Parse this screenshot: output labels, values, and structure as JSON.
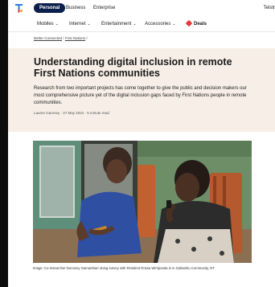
{
  "top_tabs": {
    "personal": "Personal",
    "business": "Business",
    "enterprise": "Enterprise",
    "right_link": "Telstr"
  },
  "nav": {
    "items": [
      {
        "label": "Mobiles"
      },
      {
        "label": "Internet"
      },
      {
        "label": "Entertainment"
      },
      {
        "label": "Accessories"
      }
    ],
    "deals": "Deals"
  },
  "breadcrumb": {
    "item1": "Better Connected",
    "sep": "/",
    "item2": "First Nations"
  },
  "article": {
    "title": "Understanding digital inclusion in remote First Nations communities",
    "description": "Research from two important projects has come together to give the public and decision makers our most comprehensive picture yet of the digital inclusion gaps faced by First Nations people in remote communities.",
    "meta": "Lauren Garnsey · 27 May 2024 · 5 minute read",
    "caption": "Image: Co-researcher Dunovey Gamambarr doing survey with Resident Rossa Wirripanda in in Galiwinku Community, NT"
  },
  "colors": {
    "brand_navy": "#0b1f4d",
    "hero_bg": "#f7efe7",
    "deals_red": "#e63b3b"
  }
}
